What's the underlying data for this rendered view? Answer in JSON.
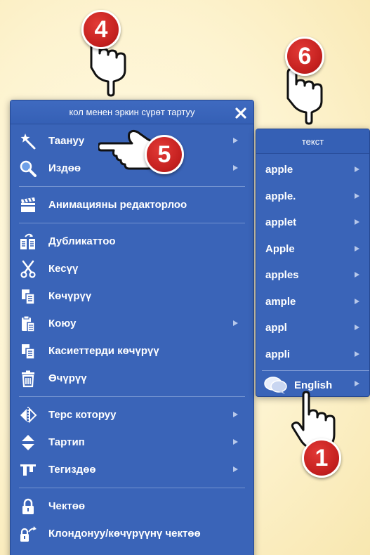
{
  "menu": {
    "title": "кол менен эркин сүрөт тартуу",
    "items": [
      {
        "label": "Таануу",
        "icon": "magic-wand-icon",
        "submenu": true
      },
      {
        "label": "Издөө",
        "icon": "search-icon",
        "submenu": true
      },
      {
        "label": "Анимацияны редакторлоо",
        "icon": "clapperboard-icon",
        "submenu": false
      },
      {
        "label": "Дубликаттоо",
        "icon": "duplicate-icon",
        "submenu": false
      },
      {
        "label": "Кесүү",
        "icon": "scissors-icon",
        "submenu": false
      },
      {
        "label": "Көчүрүү",
        "icon": "copy-icon",
        "submenu": false
      },
      {
        "label": "Коюу",
        "icon": "paste-icon",
        "submenu": true
      },
      {
        "label": "Касиеттерди көчүрүү",
        "icon": "copy-properties-icon",
        "submenu": false
      },
      {
        "label": "Өчүрүү",
        "icon": "trash-icon",
        "submenu": false
      },
      {
        "label": "Терс которуу",
        "icon": "flip-icon",
        "submenu": true
      },
      {
        "label": "Тартип",
        "icon": "order-icon",
        "submenu": true
      },
      {
        "label": "Тегиздөө",
        "icon": "align-icon",
        "submenu": true
      },
      {
        "label": "Чектөө",
        "icon": "lock-icon",
        "submenu": false
      },
      {
        "label": "Клондонуу/көчүрүүнү чектөө",
        "icon": "lock-clone-icon",
        "submenu": false
      }
    ]
  },
  "submenu": {
    "title": "текст",
    "items": [
      "apple",
      "apple.",
      "applet",
      "Apple",
      "apples",
      "ample",
      "appl",
      "appli"
    ],
    "language": "English"
  },
  "callouts": [
    "4",
    "6",
    "5",
    "1"
  ],
  "colors": {
    "menu_bg": "#3a64b8",
    "header_bg": "#3560b5",
    "badge_red": "#c4201f",
    "background": "#fdf3cf"
  }
}
